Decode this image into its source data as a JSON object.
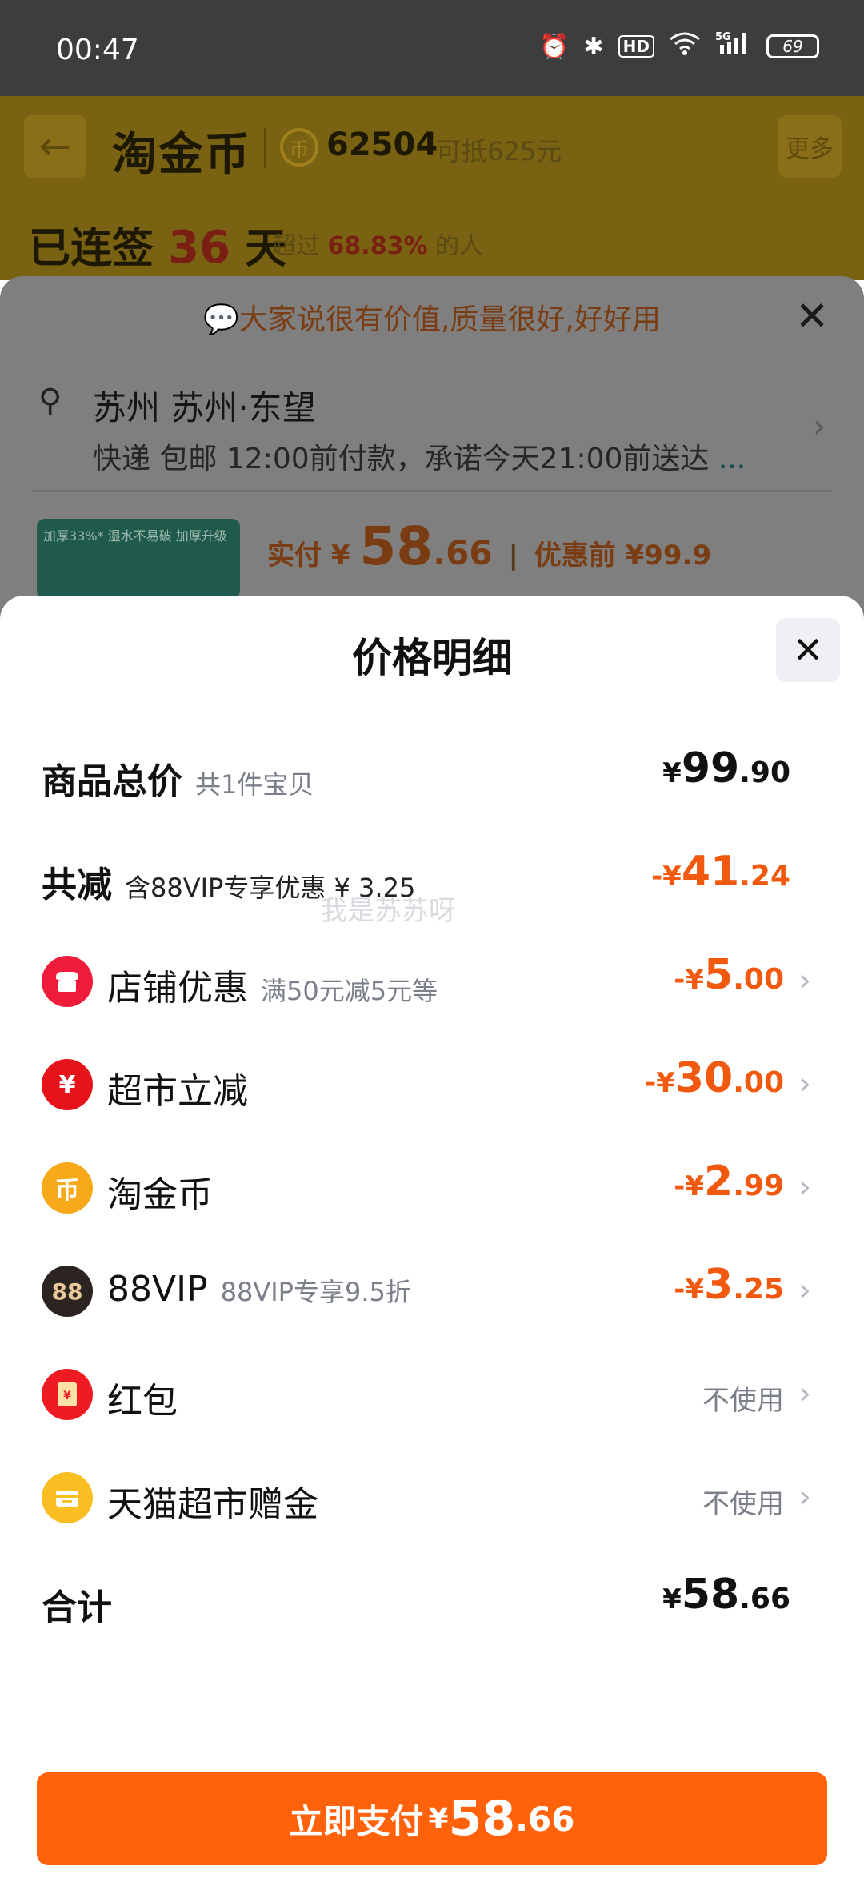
{
  "status_bar": {
    "time": "00:47",
    "network": "5G",
    "hd": "HD",
    "battery": "69"
  },
  "background": {
    "title": "淘金币",
    "coins": "62504",
    "coins_value": "可抵625元",
    "more": "更多",
    "streak_prefix": "已连签",
    "streak_days": "36",
    "streak_suffix": "天",
    "streak_over_prefix": "超过",
    "streak_pct": "68.83%",
    "streak_over_suffix": "的人",
    "banner": "大家说很有价值,质量很好,好好用",
    "address": "苏州 苏州·东望",
    "delivery": "快递 包邮 12:00前付款，承诺今天21:00前送达",
    "delivery_more": "...",
    "thumb_text": "加厚33%* 湿水不易破 加厚升级",
    "price_label": "实付",
    "price_cur": "¥",
    "price_int": "58",
    "price_dec": ".66",
    "before_label": "优惠前 ¥99.9"
  },
  "sheet": {
    "title": "价格明细",
    "watermark": "我是苏苏呀",
    "rows": [
      {
        "label": "商品总价",
        "sub": "共1件宝贝",
        "cur": "¥",
        "int": "99",
        "dec": ".90"
      },
      {
        "label": "共减",
        "sub": "含88VIP专享优惠 ¥ 3.25",
        "cur": "-¥",
        "int": "41",
        "dec": ".24"
      },
      {
        "label": "店铺优惠",
        "sub": "满50元减5元等",
        "cur": "-¥",
        "int": "5",
        "dec": ".00",
        "icon_color": "#ee1b3a"
      },
      {
        "label": "超市立减",
        "sub": "",
        "cur": "-¥",
        "int": "30",
        "dec": ".00",
        "icon_glyph": "¥",
        "icon_color": "#e7131b"
      },
      {
        "label": "淘金币",
        "sub": "",
        "cur": "-¥",
        "int": "2",
        "dec": ".99",
        "icon_glyph": "币",
        "icon_color": "#f8a91a"
      },
      {
        "label": "88VIP",
        "sub": "88VIP专享9.5折",
        "cur": "-¥",
        "int": "3",
        "dec": ".25",
        "icon_glyph": "88",
        "icon_color": "#2c2420"
      },
      {
        "label": "红包",
        "value": "不使用",
        "icon_glyph": "¥",
        "icon_color": "#ee1b22"
      },
      {
        "label": "天猫超市赠金",
        "value": "不使用",
        "icon_color": "#f8be22"
      },
      {
        "label": "合计",
        "cur": "¥",
        "int": "58",
        "dec": ".66"
      }
    ],
    "pay": {
      "label": "立即支付",
      "cur": "¥",
      "int": "58",
      "dec": ".66"
    }
  },
  "colors": {
    "accent": "#ff620a",
    "discount": "#f15a0e",
    "muted": "#7a7f8a"
  }
}
